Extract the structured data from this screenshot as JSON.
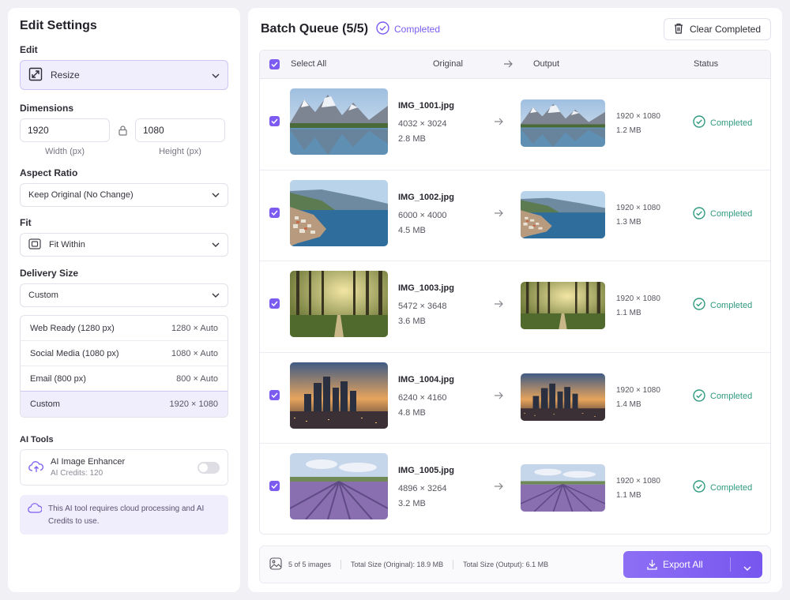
{
  "left": {
    "title": "Edit Settings",
    "edit_label": "Edit",
    "edit_value": "Resize",
    "dimensions_label": "Dimensions",
    "width_value": "1920",
    "height_value": "1080",
    "width_caption": "Width (px)",
    "height_caption": "Height (px)",
    "aspect_label": "Aspect Ratio",
    "aspect_value": "Keep Original (No Change)",
    "fit_label": "Fit",
    "fit_value": "Fit Within",
    "delivery_label": "Delivery Size",
    "delivery_value": "Custom",
    "presets": [
      {
        "name": "Web Ready (1280 px)",
        "value": "1280 × Auto"
      },
      {
        "name": "Social Media (1080 px)",
        "value": "1080 × Auto"
      },
      {
        "name": "Email (800 px)",
        "value": "800 × Auto"
      },
      {
        "name": "Custom",
        "value": "1920 × 1080"
      }
    ],
    "ai_tools_label": "AI Tools",
    "ai_enhancer_title": "AI Image Enhancer",
    "ai_credits": "AI Credits:  120",
    "ai_note": "This AI tool requires cloud processing and AI Credits to use."
  },
  "queue": {
    "title": "Batch Queue (5/5)",
    "badge": "Completed",
    "clear_label": "Clear Completed",
    "headers": {
      "select_all": "Select All",
      "original": "Original",
      "output": "Output",
      "status": "Status"
    },
    "rows": [
      {
        "name": "IMG_1001.jpg",
        "dims": "4032 × 3024",
        "size": "2.8 MB",
        "out_dims": "1920 × 1080",
        "out_size": "1.2 MB",
        "status": "Completed",
        "scene": "mountain-lake"
      },
      {
        "name": "IMG_1002.jpg",
        "dims": "6000 × 4000",
        "size": "4.5 MB",
        "out_dims": "1920 × 1080",
        "out_size": "1.3 MB",
        "status": "Completed",
        "scene": "coastal-town"
      },
      {
        "name": "IMG_1003.jpg",
        "dims": "5472 × 3648",
        "size": "3.6 MB",
        "out_dims": "1920 × 1080",
        "out_size": "1.1 MB",
        "status": "Completed",
        "scene": "forest-path"
      },
      {
        "name": "IMG_1004.jpg",
        "dims": "6240 × 4160",
        "size": "4.8 MB",
        "out_dims": "1920 × 1080",
        "out_size": "1.4 MB",
        "status": "Completed",
        "scene": "city-sunset"
      },
      {
        "name": "IMG_1005.jpg",
        "dims": "4896 × 3264",
        "size": "3.2 MB",
        "out_dims": "1920 × 1080",
        "out_size": "1.1 MB",
        "status": "Completed",
        "scene": "lavender-field"
      }
    ]
  },
  "footer": {
    "count": "5 of 5 images",
    "total_original": "Total Size (Original):  18.9 MB",
    "total_output": "Total Size (Output):  6.1 MB",
    "export_label": "Export All"
  },
  "colors": {
    "accent": "#7b5bf0",
    "success": "#2f9a7f",
    "accent_bg": "#f0edfc"
  }
}
